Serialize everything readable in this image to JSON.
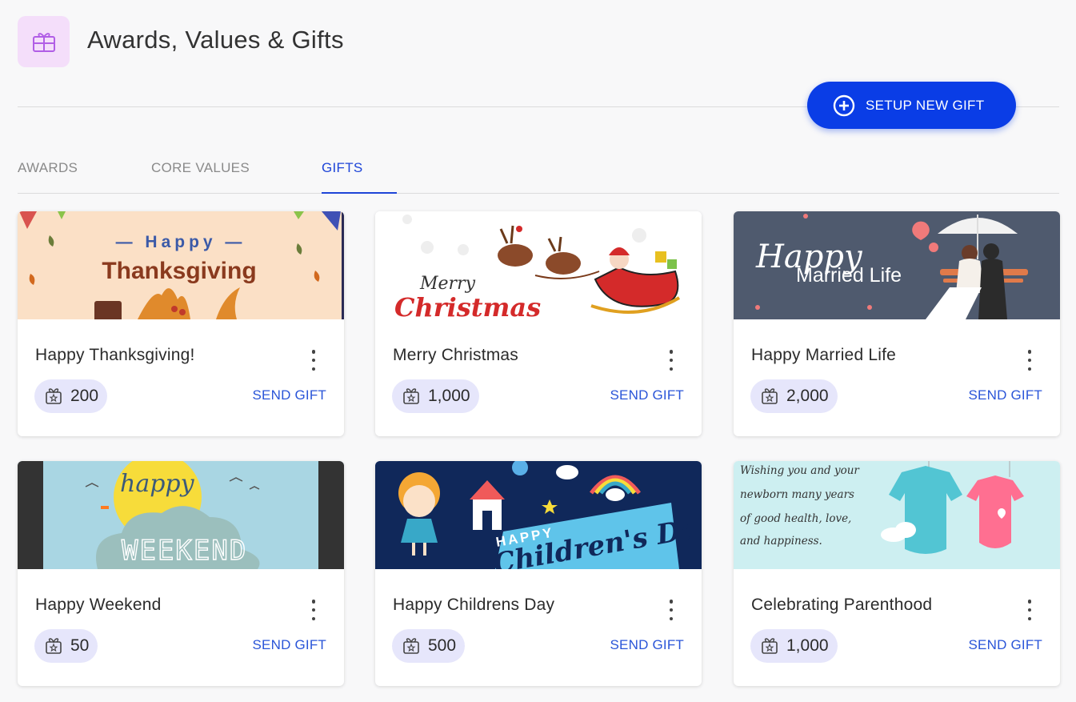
{
  "page": {
    "title": "Awards, Values & Gifts",
    "header_icon": "gift-box-icon"
  },
  "actions": {
    "setup_label": "SETUP NEW GIFT",
    "setup_icon": "add-circle-icon"
  },
  "tabs": [
    {
      "label": "AWARDS",
      "active": false
    },
    {
      "label": "CORE VALUES",
      "active": false
    },
    {
      "label": "GIFTS",
      "active": true
    }
  ],
  "colors": {
    "accent": "#0a3de6",
    "tab_active": "#1e45d8",
    "points_bg": "#e6e6fb",
    "header_icon_bg": "#f4defa"
  },
  "gifts": [
    {
      "name": "Happy Thanksgiving!",
      "points": "200",
      "send_label": "SEND GIFT",
      "art": {
        "line1": "— Happy —",
        "line2": "Thanksgiving"
      }
    },
    {
      "name": "Merry Christmas",
      "points": "1,000",
      "send_label": "SEND GIFT",
      "art": {
        "line1": "Merry",
        "line2": "Christmas"
      }
    },
    {
      "name": "Happy Married Life",
      "points": "2,000",
      "send_label": "SEND GIFT",
      "art": {
        "line1": "Happy",
        "line2": "Married Life"
      }
    },
    {
      "name": "Happy Weekend",
      "points": "50",
      "send_label": "SEND GIFT",
      "art": {
        "line1": "happy",
        "line2": "WEEKEND"
      }
    },
    {
      "name": "Happy Childrens Day",
      "points": "500",
      "send_label": "SEND GIFT",
      "art": {
        "line1": "HAPPY",
        "line2": "Children's Day"
      }
    },
    {
      "name": "Celebrating Parenthood",
      "points": "1,000",
      "send_label": "SEND GIFT",
      "art": {
        "line1": "Wishing you and your",
        "line2": "newborn many years",
        "line3": "of good health, love,",
        "line4": "and happiness."
      }
    }
  ]
}
